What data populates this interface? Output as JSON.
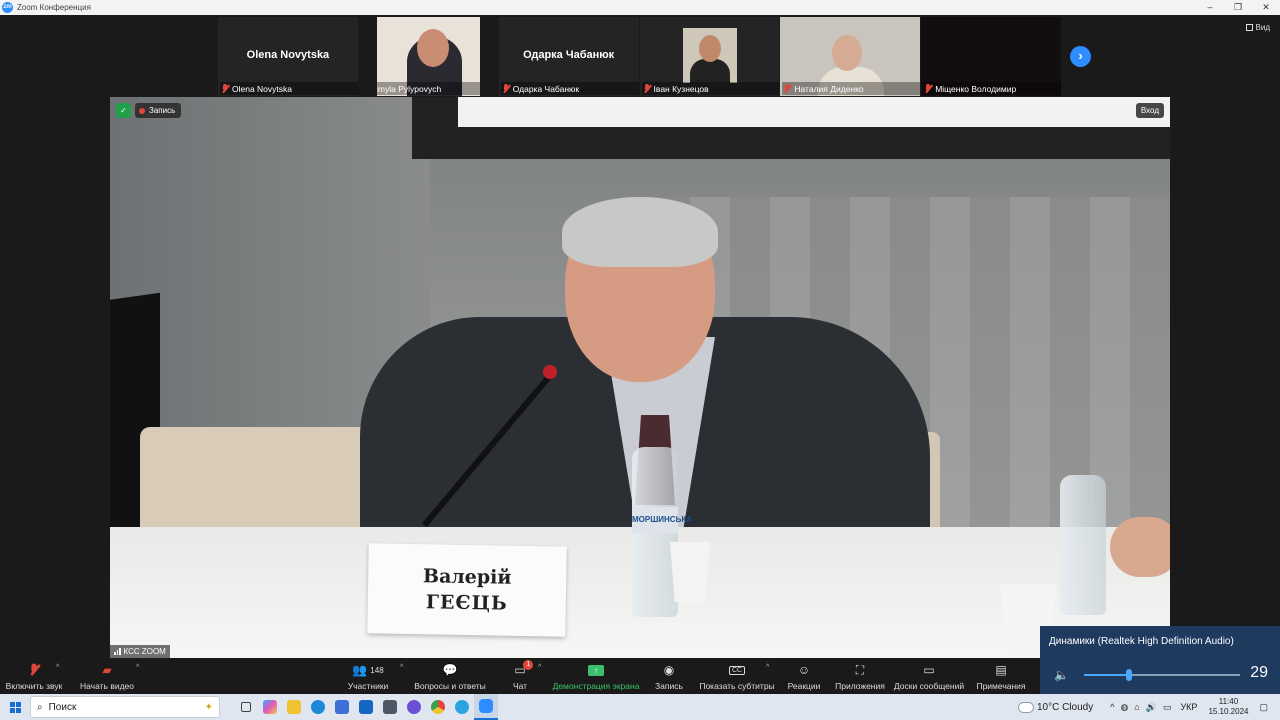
{
  "window": {
    "title": "Zoom Конференция",
    "logo_text": "zm"
  },
  "view_button": {
    "label": "Вид"
  },
  "participants_strip": [
    {
      "name": "Olena Novytska",
      "has_video": false,
      "muted": true
    },
    {
      "name": "Liudmyla Pylypovych",
      "has_video": true,
      "muted": false
    },
    {
      "name": "Одарка Чабанюк",
      "has_video": false,
      "muted": true
    },
    {
      "name": "Іван Кузнецов",
      "has_video": true,
      "muted": true
    },
    {
      "name": "Наталия Диденко",
      "has_video": true,
      "muted": true
    },
    {
      "name": "Міщенко Володимир",
      "has_video": true,
      "muted": true
    }
  ],
  "active_speaker": {
    "recording_label": "Запись",
    "exit_label": "Вход",
    "caption": "КСС ZOOM",
    "name_card_line1": "Валерій",
    "name_card_line2": "ГЕЄЦЬ",
    "bottle_label": "МОРШИНСЬКА"
  },
  "toolbar": {
    "mute": "Включить звук",
    "video": "Начать видео",
    "participants": "Участники",
    "participants_count": "148",
    "qa": "Вопросы и ответы",
    "chat": "Чат",
    "chat_badge": "1",
    "share": "Демонстрация экрана",
    "record": "Запись",
    "captions": "Показать субтитры",
    "reactions": "Реакции",
    "apps": "Приложения",
    "whiteboards": "Доски сообщений",
    "notes": "Примечания"
  },
  "volume_flyout": {
    "device": "Динамики (Realtek High Definition Audio)",
    "level": 29
  },
  "taskbar": {
    "search_placeholder": "Поиск",
    "weather": "10°C  Cloudy",
    "lang": "УКР",
    "time": "11:40",
    "date": "15.10.2024"
  }
}
